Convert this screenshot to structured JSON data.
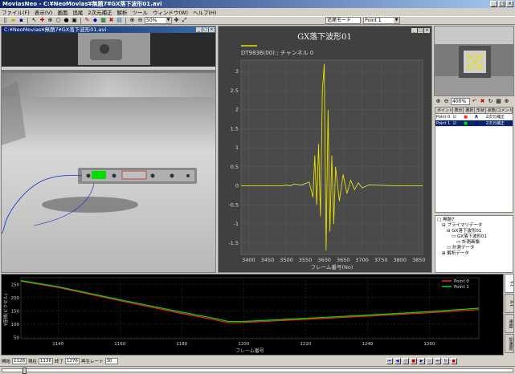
{
  "app": {
    "title": "MoviasNeo - C:¥NeoMovias¥無題7¥GX落下波形01.avi"
  },
  "menu": [
    "ファイル(F)",
    "表示(V)",
    "画面",
    "追尾",
    "2次元補正",
    "解析",
    "ツール",
    "ウィンドウ(W)",
    "ヘルプ(H)"
  ],
  "toolbar": {
    "zoom": "50%",
    "mode_label": "追尾モード",
    "point_select": "Point 1"
  },
  "video": {
    "title": "C:¥NeoMovias¥無題7¥GX落下波形01.avi"
  },
  "waveform": {
    "title": "GX落下波形01",
    "channel": "DT9836(00):: チャンネル 0",
    "xlabel": "フレーム番号(No)"
  },
  "right_panel": {
    "zoom_value": "400%",
    "point_columns": [
      "ポイント",
      "表示",
      "選択",
      "形状",
      "状態/コメント"
    ],
    "points": [
      {
        "name": "Point 0",
        "status": "2次元補正"
      },
      {
        "name": "Point 1",
        "status": "2次元補正"
      }
    ],
    "tree": [
      "無題7",
      "プライマリデータ",
      "GX落下波形01",
      "GX落下波形01",
      "計測画像",
      "計測データ",
      "解析データ"
    ]
  },
  "bottom_chart": {
    "ylabel": "Y座標(ピクセル)",
    "xlabel": "フレーム番号",
    "tabs": [
      "Y-t",
      "X-t",
      "速度",
      "加速度"
    ]
  },
  "status": {
    "start_label": "開始",
    "start_value": "1128",
    "current_label": "現在",
    "current_value": "1136",
    "end_label": "終了",
    "end_value": "1276",
    "speed_label": "再生レート",
    "speed_value": "30"
  },
  "colors": {
    "wave": "#e8e000",
    "point0": "#ff2020",
    "point1": "#00e000",
    "accent": "#0a246a"
  },
  "chart_data": [
    {
      "type": "line",
      "title": "GX落下波形01",
      "xlabel": "フレーム番号(No)",
      "ylabel": "",
      "xlim": [
        3380,
        3860
      ],
      "ylim": [
        -1.8,
        3.3
      ],
      "x_ticks": [
        3400,
        3450,
        3500,
        3550,
        3600,
        3650,
        3700,
        3750,
        3800,
        3850
      ],
      "y_ticks": [
        3.0,
        2.5,
        2.0,
        1.5,
        1.0,
        0.5,
        0.0,
        -0.5,
        -1.0,
        -1.5
      ],
      "series": [
        {
          "name": "DT9836(00):: チャンネル 0",
          "x": [
            3380,
            3490,
            3500,
            3510,
            3520,
            3540,
            3560,
            3570,
            3575,
            3580,
            3585,
            3590,
            3595,
            3600,
            3605,
            3610,
            3615,
            3620,
            3625,
            3630,
            3640,
            3650,
            3660,
            3670,
            3680,
            3690,
            3700,
            3720,
            3760,
            3800,
            3860
          ],
          "y": [
            0,
            0,
            0.02,
            0,
            0.05,
            0.02,
            0.1,
            -0.3,
            0.8,
            -0.5,
            1.1,
            -0.8,
            2.5,
            3.2,
            -1.7,
            2.0,
            -1.2,
            0.8,
            -1.0,
            0.5,
            -0.4,
            0.3,
            -0.2,
            0.15,
            -0.1,
            0.08,
            -0.05,
            0.03,
            0.01,
            0,
            0
          ]
        }
      ]
    },
    {
      "type": "line",
      "title": "",
      "xlabel": "フレーム番号",
      "ylabel": "Y座標(ピクセル)",
      "xlim": [
        1128,
        1276
      ],
      "ylim": [
        45,
        275
      ],
      "x_ticks": [
        1140,
        1160,
        1180,
        1200,
        1220,
        1240,
        1260
      ],
      "y_ticks": [
        250,
        200,
        150,
        100,
        50
      ],
      "legend": "top-right",
      "series": [
        {
          "name": "Point 0",
          "x": [
            1128,
            1140,
            1160,
            1180,
            1190,
            1195,
            1200,
            1220,
            1240,
            1260,
            1276
          ],
          "y": [
            262,
            238,
            188,
            140,
            118,
            105,
            106,
            118,
            130,
            143,
            155
          ]
        },
        {
          "name": "Point 1",
          "x": [
            1128,
            1140,
            1160,
            1180,
            1190,
            1195,
            1200,
            1220,
            1240,
            1260,
            1276
          ],
          "y": [
            264,
            241,
            192,
            145,
            123,
            110,
            110,
            122,
            134,
            147,
            160
          ]
        }
      ]
    }
  ]
}
